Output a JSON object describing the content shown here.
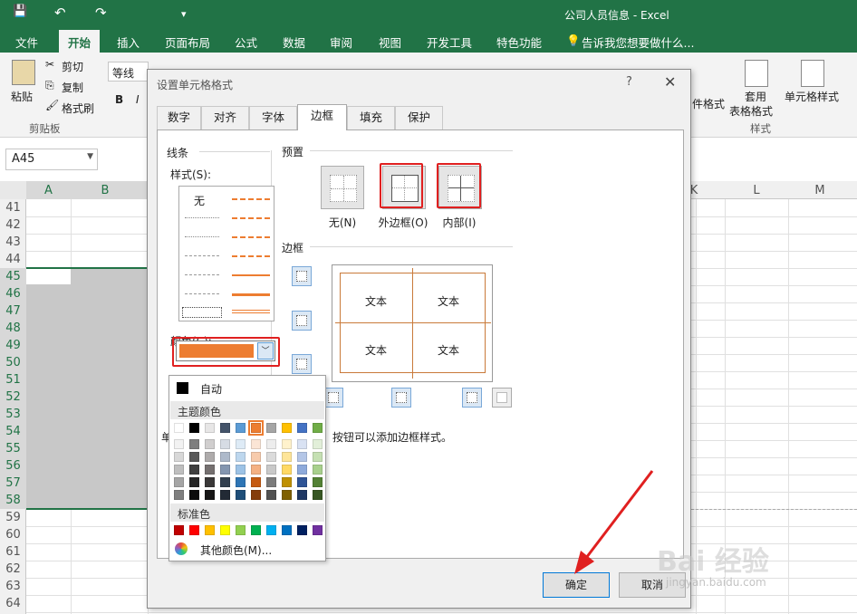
{
  "titlebar": {
    "title": "公司人员信息 - Excel",
    "qa_save": "💾",
    "qa_undo": "↶",
    "qa_redo": "↷",
    "qa_more": "▾"
  },
  "menubar": {
    "items": [
      "文件",
      "开始",
      "插入",
      "页面布局",
      "公式",
      "数据",
      "审阅",
      "视图",
      "开发工具",
      "特色功能"
    ],
    "active": "开始",
    "tellme": "告诉我您想要做什么..."
  },
  "ribbon": {
    "paste": "粘贴",
    "cut": "剪切",
    "copy": "复制",
    "format_painter": "格式刷",
    "clipboard_group": "剪贴板",
    "font_name": "等线",
    "bold": "B",
    "italic": "I",
    "cell_format": "件格式",
    "table_format": "套用",
    "table_format2": "表格格式",
    "cell_style": "单元格样式",
    "style_group": "样式"
  },
  "namebox": {
    "value": "A45"
  },
  "columns": [
    "A",
    "B",
    "K",
    "L",
    "M"
  ],
  "rows": [
    "41",
    "42",
    "43",
    "44",
    "45",
    "46",
    "47",
    "48",
    "49",
    "50",
    "51",
    "52",
    "53",
    "54",
    "55",
    "56",
    "57",
    "58",
    "59",
    "60",
    "61",
    "62",
    "63",
    "64"
  ],
  "dialog": {
    "title": "设置单元格格式",
    "help": "?",
    "close": "✕",
    "tabs": [
      "数字",
      "对齐",
      "字体",
      "边框",
      "填充",
      "保护"
    ],
    "active_tab": "边框",
    "line_section": "线条",
    "style_label": "样式(S):",
    "style_none": "无",
    "color_label": "颜色(C):",
    "color_value": "#ed7d31",
    "preset_section": "预置",
    "preset_none": "无(N)",
    "preset_outline": "外边框(O)",
    "preset_inside": "内部(I)",
    "border_section": "边框",
    "preview_text": [
      "文本",
      "文本",
      "文本",
      "文本"
    ],
    "hint_prefix": "单",
    "hint_suffix": "按钮可以添加边框样式。",
    "ok": "确定",
    "cancel": "取消"
  },
  "palette": {
    "auto": "自动",
    "theme_colors": "主题颜色",
    "standard_colors": "标准色",
    "more_colors": "其他颜色(M)...",
    "theme_top": [
      "#ffffff",
      "#000000",
      "#e7e6e6",
      "#44546a",
      "#5b9bd5",
      "#ed7d31",
      "#a5a5a5",
      "#ffc000",
      "#4472c4",
      "#70ad47"
    ],
    "theme_shades": [
      [
        "#f2f2f2",
        "#7f7f7f",
        "#d0cece",
        "#d6dce4",
        "#deebf6",
        "#fbe5d5",
        "#ededed",
        "#fff2cc",
        "#d9e2f3",
        "#e2efd9"
      ],
      [
        "#d8d8d8",
        "#595959",
        "#aeabab",
        "#adb9ca",
        "#bdd7ee",
        "#f7cbac",
        "#dbdbdb",
        "#fee599",
        "#b4c6e7",
        "#c5e0b3"
      ],
      [
        "#bfbfbf",
        "#3f3f3f",
        "#757070",
        "#8496b0",
        "#9dc3e6",
        "#f4b183",
        "#c9c9c9",
        "#ffd965",
        "#8eaadb",
        "#a8d08d"
      ],
      [
        "#a5a5a5",
        "#262626",
        "#3a3838",
        "#323f4f",
        "#2e75b5",
        "#c55a11",
        "#7b7b7b",
        "#bf9000",
        "#2f5496",
        "#538135"
      ],
      [
        "#7f7f7f",
        "#0c0c0c",
        "#171616",
        "#222a35",
        "#1e4e79",
        "#843c0b",
        "#525252",
        "#7f6000",
        "#1f3864",
        "#375623"
      ]
    ],
    "standard": [
      "#c00000",
      "#ff0000",
      "#ffc000",
      "#ffff00",
      "#92d050",
      "#00b050",
      "#00b0f0",
      "#0070c0",
      "#002060",
      "#7030a0"
    ]
  },
  "watermark": {
    "brand": "Bai 经验",
    "url": "jingyan.baidu.com"
  }
}
